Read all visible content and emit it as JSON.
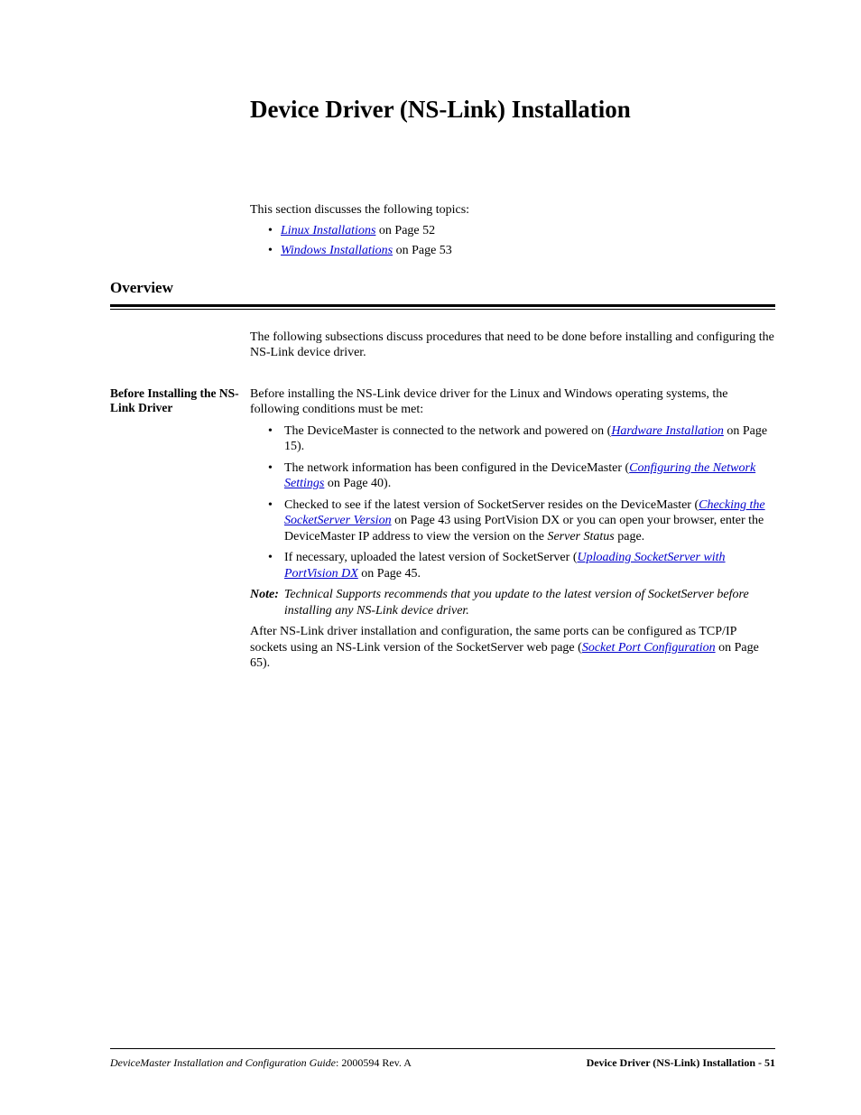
{
  "title": "Device Driver (NS-Link) Installation",
  "intro": {
    "lead": "This section discusses the following topics:",
    "items": [
      {
        "link": "Linux Installations",
        "rest": " on Page 52"
      },
      {
        "link": "Windows Installations",
        "rest": " on Page 53"
      }
    ]
  },
  "overview": {
    "heading": "Overview",
    "intro": "The following subsections discuss procedures that need to be done before installing and configuring the NS-Link device driver."
  },
  "before": {
    "side_heading": "Before Installing the NS-Link Driver",
    "lead": "Before installing the NS-Link device driver for the Linux and Windows operating systems, the following conditions must be met:",
    "bullets": {
      "b1_pre": "The DeviceMaster is connected to the network and powered on (",
      "b1_link": "Hardware Installation",
      "b1_post": " on Page 15).",
      "b2_pre": "The network information has been configured in the DeviceMaster (",
      "b2_link": "Configuring the Network Settings",
      "b2_post": " on Page 40).",
      "b3_pre": "Checked to see if the latest version of SocketServer resides on the DeviceMaster (",
      "b3_link": "Checking the SocketServer Version",
      "b3_mid": " on Page 43 using PortVision DX or you can open your browser, enter the DeviceMaster IP address to view the version on the ",
      "b3_em": "Server Status",
      "b3_post": " page.",
      "b4_pre": "If necessary, uploaded the latest version of SocketServer (",
      "b4_link": "Uploading SocketServer with PortVision DX",
      "b4_post": " on Page 45."
    },
    "note_label": "Note:",
    "note_text": "Technical Supports recommends that you update to the latest version of SocketServer before installing any NS-Link device driver.",
    "after_pre": "After NS-Link driver installation and configuration, the same ports can be configured as TCP/IP sockets using an NS-Link version of the SocketServer web page (",
    "after_link": "Socket Port Configuration",
    "after_post": " on Page 65)."
  },
  "footer": {
    "left_italic": "DeviceMaster Installation and Configuration Guide",
    "left_plain": ": 2000594 Rev. A",
    "right": "Device Driver (NS-Link) Installation  - 51"
  }
}
